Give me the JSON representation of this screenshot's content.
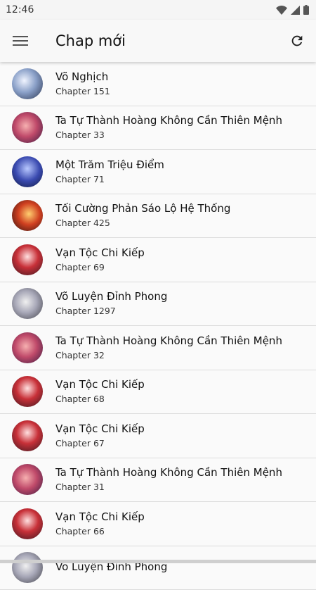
{
  "status": {
    "time": "12:46"
  },
  "appbar": {
    "title": "Chap mới"
  },
  "items": [
    {
      "title": "Võ Nghịch",
      "chapter": "Chapter 151",
      "avatar": "av-a"
    },
    {
      "title": "Ta Tự Thành Hoàng Không Cần Thiên Mệnh",
      "chapter": "Chapter 33",
      "avatar": "av-b"
    },
    {
      "title": "Một Trăm Triệu Điểm",
      "chapter": "Chapter 71",
      "avatar": "av-c"
    },
    {
      "title": "Tối Cường Phản Sáo Lộ Hệ Thống",
      "chapter": "Chapter 425",
      "avatar": "av-d"
    },
    {
      "title": "Vạn Tộc Chi Kiếp",
      "chapter": "Chapter 69",
      "avatar": "av-e"
    },
    {
      "title": "Võ Luyện Đỉnh Phong",
      "chapter": "Chapter 1297",
      "avatar": "av-f"
    },
    {
      "title": "Ta Tự Thành Hoàng Không Cần Thiên Mệnh",
      "chapter": "Chapter 32",
      "avatar": "av-b"
    },
    {
      "title": "Vạn Tộc Chi Kiếp",
      "chapter": "Chapter 68",
      "avatar": "av-e"
    },
    {
      "title": "Vạn Tộc Chi Kiếp",
      "chapter": "Chapter 67",
      "avatar": "av-e"
    },
    {
      "title": "Ta Tự Thành Hoàng Không Cần Thiên Mệnh",
      "chapter": "Chapter 31",
      "avatar": "av-b"
    },
    {
      "title": "Vạn Tộc Chi Kiếp",
      "chapter": "Chapter 66",
      "avatar": "av-e"
    },
    {
      "title": "Võ Luyện Đỉnh Phong",
      "chapter": "",
      "avatar": "av-f"
    }
  ]
}
